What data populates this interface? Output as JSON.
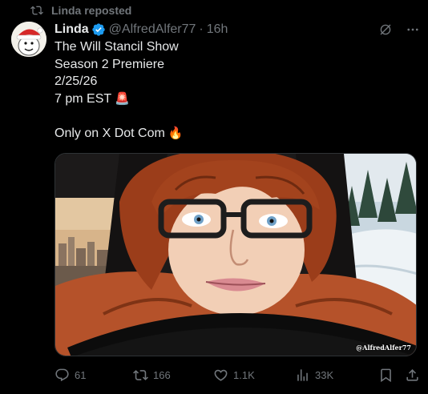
{
  "repost": {
    "label": "Linda reposted",
    "icon": "repost-icon"
  },
  "author": {
    "name": "Linda",
    "handle": "@AlfredAlfer77",
    "time": "16h",
    "verified": true,
    "avatar_icon": "avatar-santa-hat"
  },
  "post": {
    "lines": [
      "The Will Stancil Show",
      "Season 2 Premiere",
      "2/25/26",
      "7 pm EST"
    ],
    "line4_emoji": "🚨",
    "last_line": "Only on X Dot Com",
    "last_emoji": "🔥"
  },
  "media": {
    "watermark": "@AlfredAlfer77"
  },
  "stats": {
    "replies": "61",
    "reposts": "166",
    "likes": "1.1K",
    "views": "33K"
  },
  "colors": {
    "background": "#000000",
    "text": "#e7e9ea",
    "muted": "#71767b",
    "verified": "#1d9bf0"
  }
}
